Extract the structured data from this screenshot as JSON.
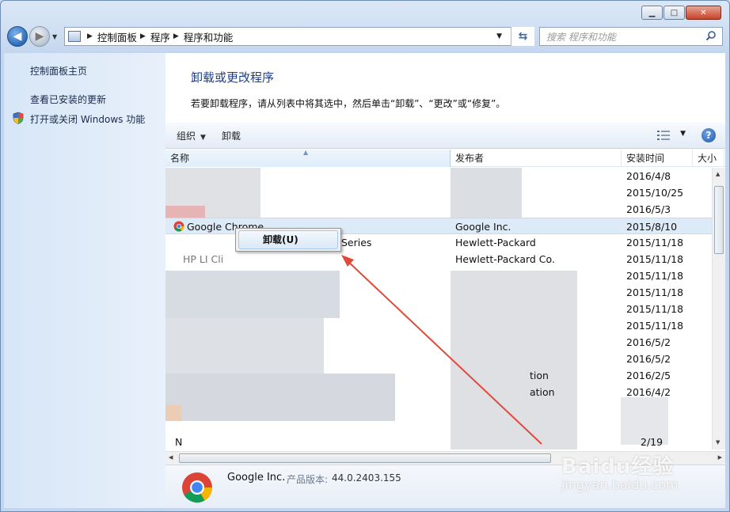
{
  "window": {
    "caption": {
      "minimize": "▁",
      "maximize": "□",
      "close": "✕"
    }
  },
  "nav": {
    "breadcrumbs": [
      "控制面板",
      "程序",
      "程序和功能"
    ],
    "search_placeholder": "搜索 程序和功能"
  },
  "sidebar": {
    "items": [
      {
        "label": "控制面板主页",
        "icon": null
      },
      {
        "label": "查看已安装的更新",
        "icon": null
      },
      {
        "label": "打开或关闭 Windows 功能",
        "icon": "shield-icon"
      }
    ]
  },
  "main": {
    "title": "卸载或更改程序",
    "description": "若要卸载程序，请从列表中将其选中，然后单击“卸载”、“更改”或“修复”。",
    "toolbar": {
      "organize": "组织",
      "uninstall": "卸载"
    },
    "columns": [
      "名称",
      "发布者",
      "安装时间",
      "大小"
    ],
    "rows": [
      {
        "name": "",
        "publisher": "",
        "date": "2016/4/8",
        "selected": false
      },
      {
        "name": "",
        "publisher": "",
        "date": "2015/10/25",
        "selected": false
      },
      {
        "name": "",
        "publisher": "",
        "date": "2016/5/3",
        "selected": false
      },
      {
        "name": "Google Chrome",
        "publisher": "Google Inc.",
        "date": "2015/8/10",
        "selected": true
      },
      {
        "name": "Series",
        "publisher": "Hewlett-Packard",
        "date": "2015/11/18",
        "selected": false
      },
      {
        "name": "HP LI Cli",
        "publisher": "Hewlett-Packard Co.",
        "date": "2015/11/18",
        "selected": false
      },
      {
        "name": "",
        "publisher": "",
        "date": "2015/11/18",
        "selected": false
      },
      {
        "name": "",
        "publisher": "",
        "date": "2015/11/18",
        "selected": false
      },
      {
        "name": "",
        "publisher": "",
        "date": "2015/11/18",
        "selected": false
      },
      {
        "name": "",
        "publisher": "",
        "date": "2015/11/18",
        "selected": false
      },
      {
        "name": "",
        "publisher": "",
        "date": "2016/5/2",
        "selected": false
      },
      {
        "name": "",
        "publisher": "",
        "date": "2016/5/2",
        "selected": false
      },
      {
        "name": "",
        "publisher": "tion",
        "date": "2016/2/5",
        "selected": false
      },
      {
        "name": "",
        "publisher": "ation",
        "date": "2016/4/2",
        "selected": false
      },
      {
        "name": "",
        "publisher": "",
        "date": "",
        "selected": false
      },
      {
        "name": "",
        "publisher": "",
        "date": "",
        "selected": false
      },
      {
        "name": "N",
        "publisher": "",
        "date": "2/19",
        "selected": false
      }
    ],
    "context_menu": {
      "uninstall": "卸载(U)"
    },
    "details": {
      "publisher": "Google Inc.",
      "version_label": "产品版本:",
      "version": "44.0.2403.155"
    }
  },
  "watermark": {
    "brand": "Baidu经验",
    "url": "jingyan.baidu.com"
  },
  "colors": {
    "accent_title": "#1d3f8a",
    "annotation_arrow": "#e04a3c",
    "selection": "#ddebf9"
  }
}
